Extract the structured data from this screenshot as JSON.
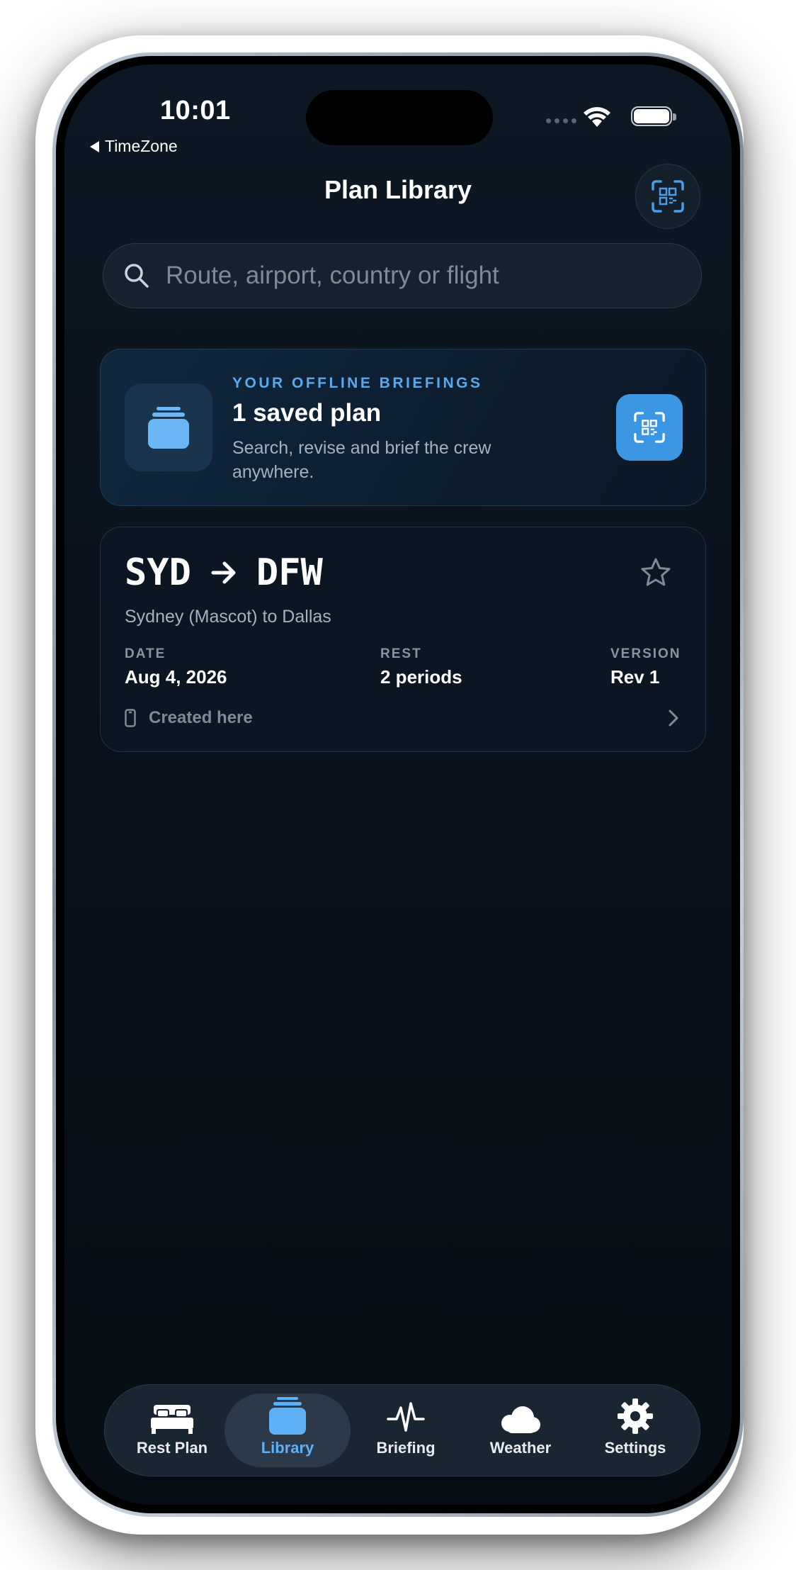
{
  "status_bar": {
    "time": "10:01",
    "back_app": "TimeZone"
  },
  "header": {
    "title": "Plan Library"
  },
  "search": {
    "placeholder": "Route, airport, country or flight"
  },
  "hero": {
    "eyebrow": "YOUR OFFLINE BRIEFINGS",
    "title": "1 saved plan",
    "subtitle": "Search, revise and brief the crew anywhere."
  },
  "plans": [
    {
      "origin": "SYD",
      "destination": "DFW",
      "description": "Sydney (Mascot) to Dallas",
      "date_label": "DATE",
      "date": "Aug 4, 2026",
      "rest_label": "REST",
      "rest": "2 periods",
      "version_label": "VERSION",
      "version": "Rev 1",
      "source": "Created here"
    }
  ],
  "tabs": [
    {
      "label": "Rest Plan",
      "icon": "bed-icon",
      "active": false
    },
    {
      "label": "Library",
      "icon": "stack-icon",
      "active": true
    },
    {
      "label": "Briefing",
      "icon": "waveform-icon",
      "active": false
    },
    {
      "label": "Weather",
      "icon": "cloud-icon",
      "active": false
    },
    {
      "label": "Settings",
      "icon": "gear-icon",
      "active": false
    }
  ],
  "colors": {
    "accent": "#5eb0f7",
    "scan_button": "#3b96e4",
    "background": "#0a131d"
  }
}
